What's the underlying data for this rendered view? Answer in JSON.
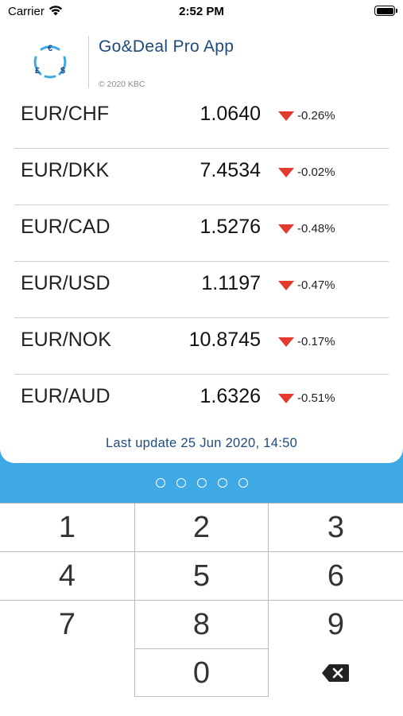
{
  "status_bar": {
    "carrier": "Carrier",
    "time": "2:52 PM"
  },
  "header": {
    "title": "Go&Deal Pro App",
    "copyright": "© 2020 KBC",
    "logo_icon": "currency-exchange-logo-icon",
    "logo_symbols": [
      "€",
      "£",
      "$"
    ],
    "brand_color": "#3fa9e5",
    "title_color": "#1e4a7a"
  },
  "rates": [
    {
      "pair": "EUR/CHF",
      "value": "1.0640",
      "change": "-0.26%",
      "direction": "down"
    },
    {
      "pair": "EUR/DKK",
      "value": "7.4534",
      "change": "-0.02%",
      "direction": "down"
    },
    {
      "pair": "EUR/CAD",
      "value": "1.5276",
      "change": "-0.48%",
      "direction": "down"
    },
    {
      "pair": "EUR/USD",
      "value": "1.1197",
      "change": "-0.47%",
      "direction": "down"
    },
    {
      "pair": "EUR/NOK",
      "value": "10.8745",
      "change": "-0.17%",
      "direction": "down"
    },
    {
      "pair": "EUR/AUD",
      "value": "1.6326",
      "change": "-0.51%",
      "direction": "down"
    }
  ],
  "last_update": "Last update 25 Jun 2020, 14:50",
  "pin_dots_count": 5,
  "keypad": {
    "keys": [
      "1",
      "2",
      "3",
      "4",
      "5",
      "6",
      "7",
      "8",
      "9",
      "0"
    ],
    "backspace_icon": "backspace-icon"
  },
  "colors": {
    "down_arrow": "#e23b2e",
    "band": "#3fa9e5"
  }
}
